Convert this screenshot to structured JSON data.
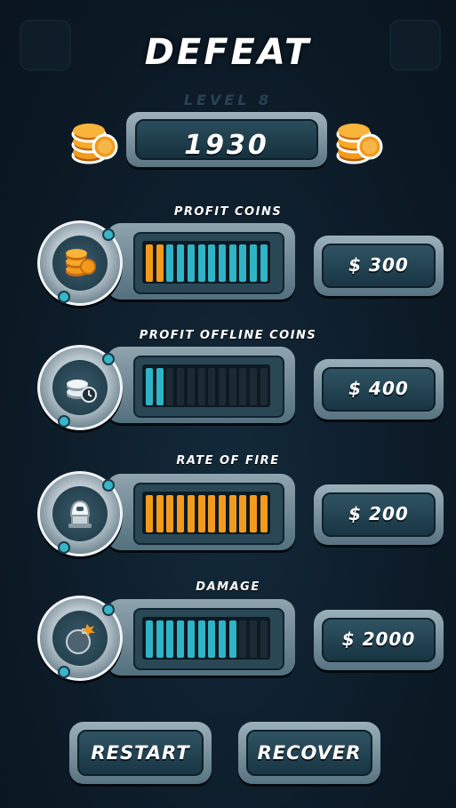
{
  "screen": {
    "title": "DEFEAT",
    "level_label": "LEVEL 8",
    "coins": "1930"
  },
  "colors": {
    "filled_orange": "#f39a1d",
    "filled_cyan": "#2fb4c6",
    "empty": "#1b2a33"
  },
  "upgrades": [
    {
      "label": "PROFIT COINS",
      "icon": "coin-stack-icon",
      "price": "$ 300",
      "segments": [
        "orange",
        "orange",
        "cyan",
        "cyan",
        "cyan",
        "cyan",
        "cyan",
        "cyan",
        "cyan",
        "cyan",
        "cyan",
        "cyan"
      ]
    },
    {
      "label": "PROFIT OFFLINE COINS",
      "icon": "offline-coins-icon",
      "price": "$ 400",
      "segments": [
        "cyan",
        "cyan",
        "empty",
        "empty",
        "empty",
        "empty",
        "empty",
        "empty",
        "empty",
        "empty",
        "empty",
        "empty"
      ]
    },
    {
      "label": "RATE OF FIRE",
      "icon": "turret-icon",
      "price": "$ 200",
      "segments": [
        "orange",
        "orange",
        "orange",
        "orange",
        "orange",
        "orange",
        "orange",
        "orange",
        "orange",
        "orange",
        "orange",
        "orange"
      ]
    },
    {
      "label": "DAMAGE",
      "icon": "bomb-icon",
      "price": "$ 2000",
      "segments": [
        "cyan",
        "cyan",
        "cyan",
        "cyan",
        "cyan",
        "cyan",
        "cyan",
        "cyan",
        "cyan",
        "empty",
        "empty",
        "empty"
      ]
    }
  ],
  "buttons": {
    "restart": "RESTART",
    "recover": "RECOVER"
  }
}
